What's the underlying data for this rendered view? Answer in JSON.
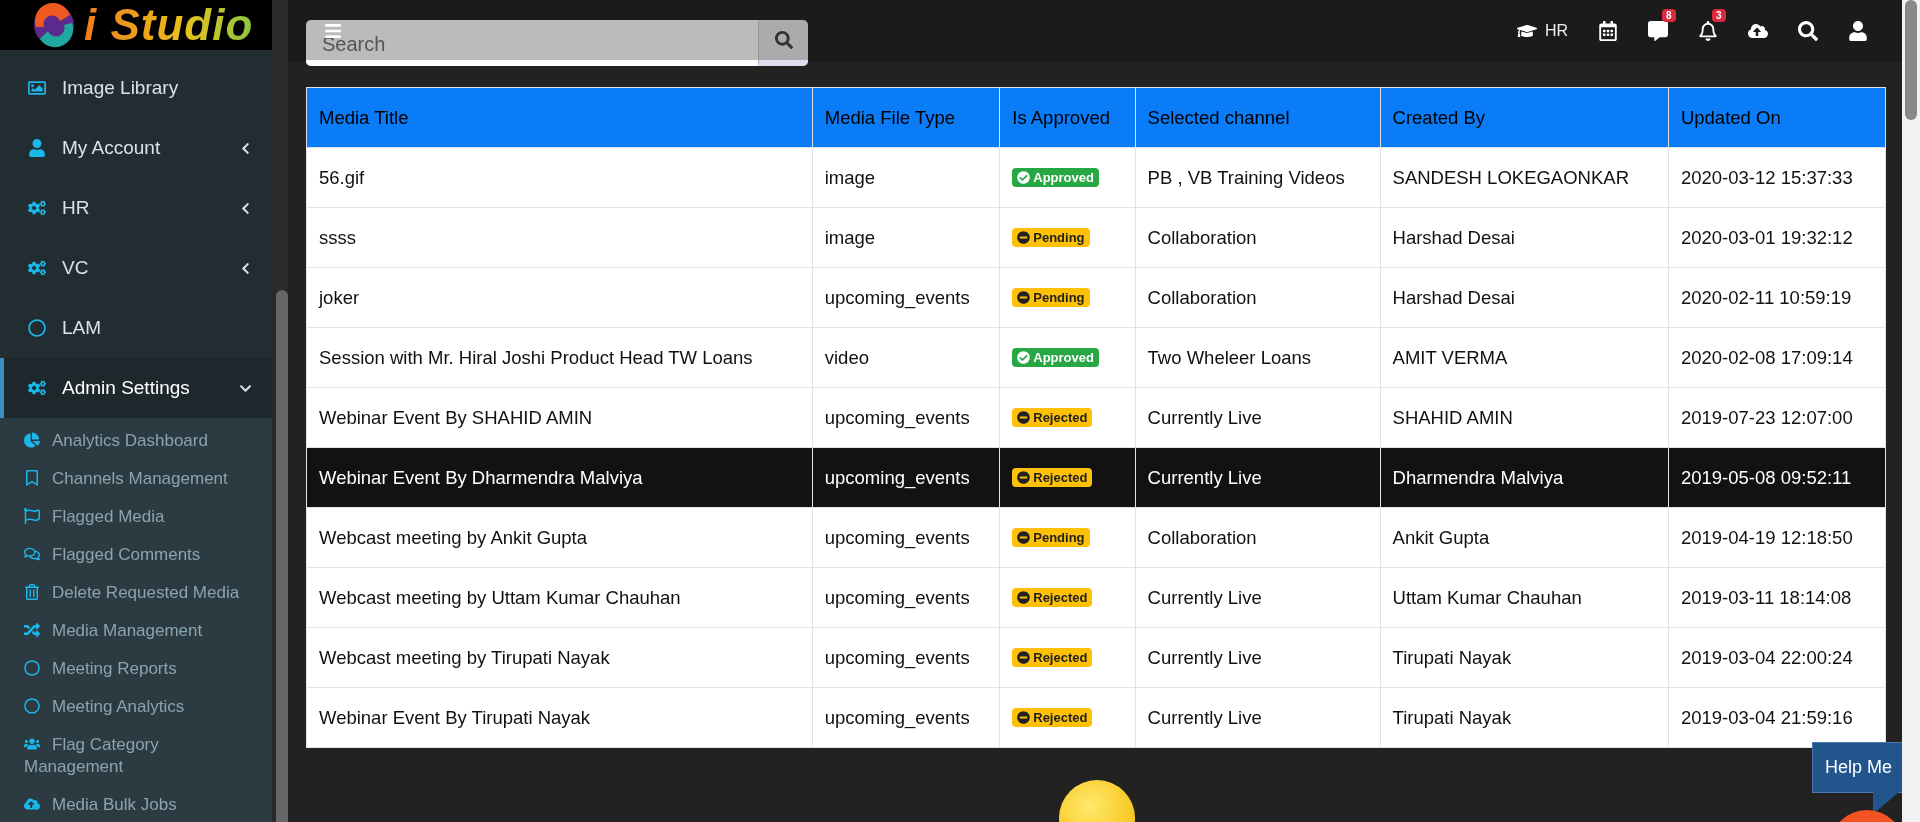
{
  "logo": {
    "text": "i Studio"
  },
  "sidebar": {
    "items": [
      {
        "label": "Image Library",
        "kind": "link",
        "selected": false
      },
      {
        "label": "My Account",
        "kind": "menu",
        "expanded": false,
        "selected": false
      },
      {
        "label": "HR",
        "kind": "menu",
        "expanded": false,
        "selected": false
      },
      {
        "label": "VC",
        "kind": "menu",
        "expanded": false,
        "selected": false
      },
      {
        "label": "LAM",
        "kind": "link",
        "selected": false
      },
      {
        "label": "Admin Settings",
        "kind": "menu",
        "expanded": true,
        "selected": true,
        "children": [
          {
            "label": "Analytics Dashboard"
          },
          {
            "label": "Channels Management"
          },
          {
            "label": "Flagged Media"
          },
          {
            "label": "Flagged Comments"
          },
          {
            "label": "Delete Requested Media"
          },
          {
            "label": "Media Management"
          },
          {
            "label": "Meeting Reports"
          },
          {
            "label": "Meeting Analytics"
          },
          {
            "label": "Flag Category Management"
          },
          {
            "label": "Media Bulk Jobs"
          }
        ]
      }
    ]
  },
  "search": {
    "placeholder": "Search"
  },
  "topbar": {
    "role": "HR",
    "messages_badge": "8",
    "notifications_badge": "3"
  },
  "table": {
    "columns": [
      "Media Title",
      "Media File Type",
      "Is Approved",
      "Selected channel",
      "Created By",
      "Updated On"
    ],
    "rows": [
      {
        "title": "56.gif",
        "type": "image",
        "status": {
          "kind": "approved",
          "label": "Approved"
        },
        "channel": "PB , VB Training Videos",
        "created_by": "SANDESH LOKEGAONKAR",
        "updated": "2020-03-12 15:37:33",
        "selected": false
      },
      {
        "title": "ssss",
        "type": "image",
        "status": {
          "kind": "pending",
          "label": "Pending"
        },
        "channel": "Collaboration",
        "created_by": "Harshad Desai",
        "updated": "2020-03-01 19:32:12",
        "selected": false
      },
      {
        "title": "joker",
        "type": "upcoming_events",
        "status": {
          "kind": "pending",
          "label": "Pending"
        },
        "channel": "Collaboration",
        "created_by": "Harshad Desai",
        "updated": "2020-02-11 10:59:19",
        "selected": false
      },
      {
        "title": "Session with Mr. Hiral Joshi Product Head TW Loans",
        "type": "video",
        "status": {
          "kind": "approved",
          "label": "Approved"
        },
        "channel": "Two Wheleer Loans",
        "created_by": "AMIT VERMA",
        "updated": "2020-02-08 17:09:14",
        "selected": false
      },
      {
        "title": "Webinar Event By SHAHID AMIN",
        "type": "upcoming_events",
        "status": {
          "kind": "rejected",
          "label": "Rejected"
        },
        "channel": "Currently Live",
        "created_by": "SHAHID AMIN",
        "updated": "2019-07-23 12:07:00",
        "selected": false
      },
      {
        "title": "Webinar Event By Dharmendra Malviya",
        "type": "upcoming_events",
        "status": {
          "kind": "rejected",
          "label": "Rejected"
        },
        "channel": "Currently Live",
        "created_by": "Dharmendra Malviya",
        "updated": "2019-05-08 09:52:11",
        "selected": true
      },
      {
        "title": "Webcast meeting by Ankit Gupta",
        "type": "upcoming_events",
        "status": {
          "kind": "pending",
          "label": "Pending"
        },
        "channel": "Collaboration",
        "created_by": "Ankit Gupta",
        "updated": "2019-04-19 12:18:50",
        "selected": false
      },
      {
        "title": "Webcast meeting by Uttam Kumar Chauhan",
        "type": "upcoming_events",
        "status": {
          "kind": "rejected",
          "label": "Rejected"
        },
        "channel": "Currently Live",
        "created_by": "Uttam Kumar Chauhan",
        "updated": "2019-03-11 18:14:08",
        "selected": false
      },
      {
        "title": "Webcast meeting by Tirupati Nayak",
        "type": "upcoming_events",
        "status": {
          "kind": "rejected",
          "label": "Rejected"
        },
        "channel": "Currently Live",
        "created_by": "Tirupati Nayak",
        "updated": "2019-03-04 22:00:24",
        "selected": false
      },
      {
        "title": "Webinar Event By Tirupati Nayak",
        "type": "upcoming_events",
        "status": {
          "kind": "rejected",
          "label": "Rejected"
        },
        "channel": "Currently Live",
        "created_by": "Tirupati Nayak",
        "updated": "2019-03-04 21:59:16",
        "selected": false
      }
    ]
  },
  "help": {
    "label": "Help Me"
  }
}
